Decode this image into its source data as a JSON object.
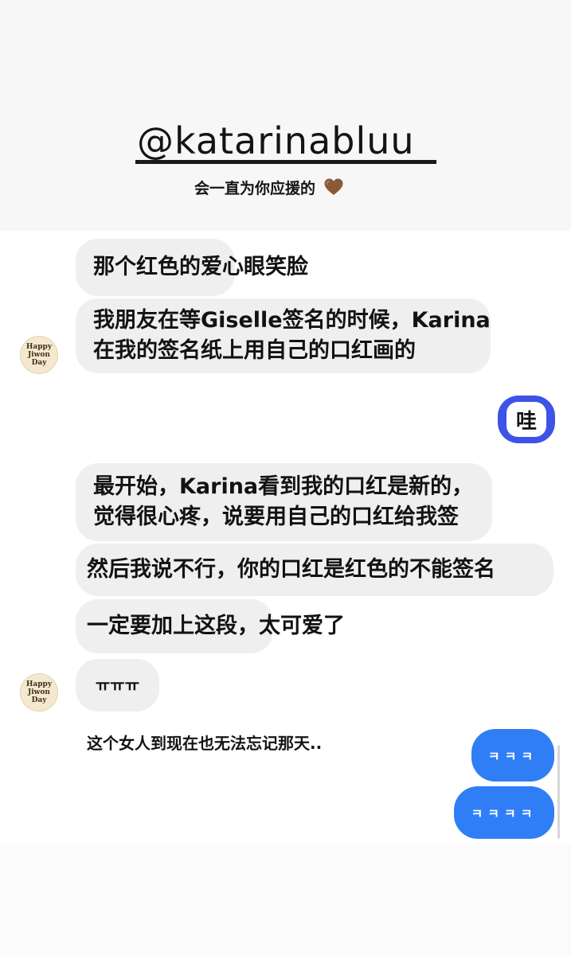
{
  "header": {
    "handle": "@katarinabluu",
    "subtitle": "会一直为你应援的",
    "subtitle_icon": "brown-heart-icon",
    "heart_color": "#8a5a36"
  },
  "avatar": {
    "lines": [
      "Happy",
      "Jiwon",
      "Day"
    ]
  },
  "messages": {
    "m1": "那个红色的爱心眼笑脸",
    "m2_line1": "我朋友在等Giselle签名的时候，Karina",
    "m2_line2": "在我的签名纸上用自己的口红画的",
    "wa": "哇",
    "m3_line1": "最开始，Karina看到我的口红是新的，",
    "m3_line2": "觉得很心疼，说要用自己的口红给我签",
    "m4": "然后我说不行，你的口红是红色的不能签名",
    "m5": "一定要加上这段，太可爱了",
    "m6": "ㅠㅠㅠ",
    "caption": "这个女人到现在也无法忘记那天..",
    "blue1": "ㅋㅋㅋ",
    "blue2": "ㅋㅋㅋㅋ"
  },
  "colors": {
    "accent_blue": "#2f7ef6",
    "wa_bubble": "#3e53e6",
    "bubble_gray": "#efefef"
  }
}
